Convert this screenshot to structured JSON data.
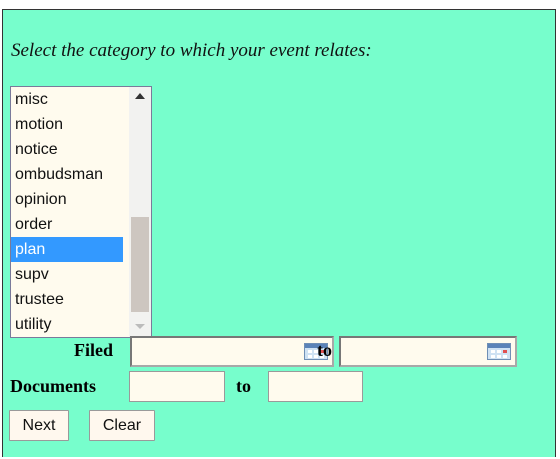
{
  "prompt": "Select the category to which your event relates:",
  "category_list": {
    "items": [
      "misc",
      "motion",
      "notice",
      "ombudsman",
      "opinion",
      "order",
      "plan",
      "supv",
      "trustee",
      "utility"
    ],
    "selected": "plan"
  },
  "filed": {
    "label": "Filed",
    "from_value": "",
    "to_label": "to",
    "to_value": ""
  },
  "documents": {
    "label": "Documents",
    "from_value": "",
    "to_label": "to",
    "to_value": ""
  },
  "buttons": {
    "next": "Next",
    "clear": "Clear"
  },
  "colors": {
    "background": "#77fecc",
    "field": "#fffbee",
    "selected": "#3399ff"
  }
}
